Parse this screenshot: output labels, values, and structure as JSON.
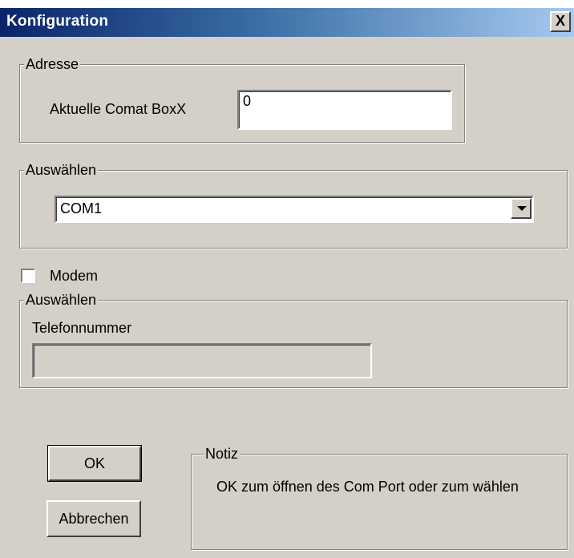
{
  "window": {
    "title": "Konfiguration",
    "close_label": "X"
  },
  "address_group": {
    "legend": "Adresse",
    "label": "Aktuelle Comat BoxX",
    "value": "0"
  },
  "select_group": {
    "legend": "Auswählen",
    "selected_port": "COM1"
  },
  "modem": {
    "checkbox_label": "Modem",
    "checked": false
  },
  "dial_group": {
    "legend": "Auswählen",
    "phone_label": "Telefonnummer",
    "phone_value": ""
  },
  "buttons": {
    "ok": "OK",
    "cancel": "Abbrechen"
  },
  "note_group": {
    "legend": "Notiz",
    "text": "OK zum öffnen des Com Port oder zum wählen"
  },
  "colors": {
    "title_start": "#0a246a",
    "title_end": "#a6caf0",
    "face": "#d4d0c8"
  }
}
